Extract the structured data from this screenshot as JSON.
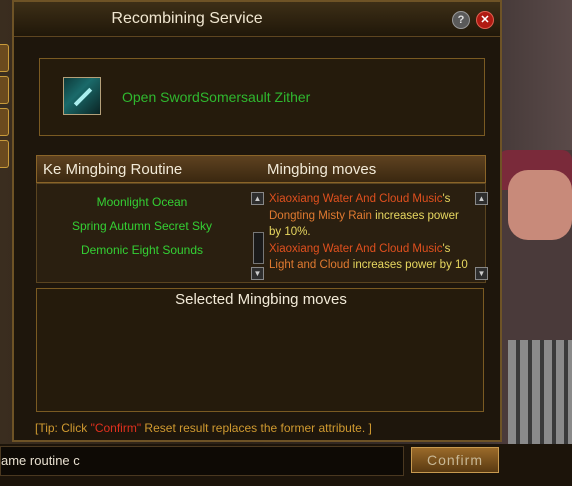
{
  "window": {
    "title": "Recombining Service",
    "help_icon": "question-icon",
    "close_icon": "close-icon"
  },
  "item": {
    "name": "Open SwordSomersault Zither",
    "icon": "zither-sword-icon"
  },
  "headers": {
    "routine": "Ke Mingbing Routine",
    "moves": "Mingbing moves",
    "selected": "Selected Mingbing moves"
  },
  "routines": [
    "Moonlight Ocean",
    "Spring Autumn Secret Sky",
    "Demonic Eight Sounds"
  ],
  "moves": [
    {
      "source": "Xiaoxiang Water And Cloud Music",
      "sep": "'s ",
      "move": "Dongting Misty Rain",
      "effect": " increases power by",
      "value": " 10%."
    },
    {
      "source": "Xiaoxiang Water And Cloud Music",
      "sep": "'s ",
      "move": "Light and Cloud",
      "effect": " increases power by 10",
      "value": ""
    }
  ],
  "tip": {
    "prefix": "[Tip: Click ",
    "highlight": "\"Confirm\"",
    "suffix": " Reset result replaces the former attribute. ]"
  },
  "input": {
    "value": "ame routine c"
  },
  "confirm_label": "Confirm",
  "colors": {
    "accent_green": "#34d034",
    "highlight_red": "#e0301e",
    "move_orange": "#e07a30",
    "effect_yellow": "#e8d860"
  }
}
